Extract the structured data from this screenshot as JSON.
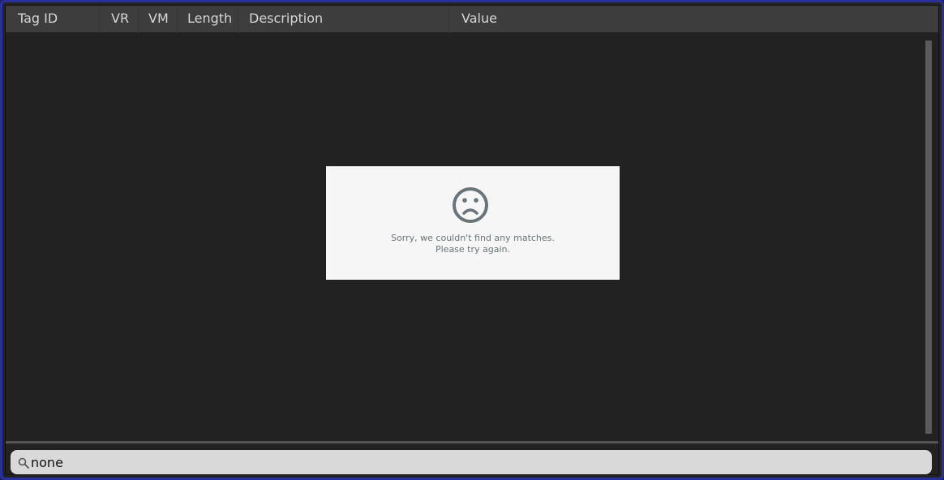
{
  "table": {
    "columns": [
      {
        "label": "Tag ID"
      },
      {
        "label": "VR"
      },
      {
        "label": "VM"
      },
      {
        "label": "Length"
      },
      {
        "label": "Description"
      },
      {
        "label": "Value"
      }
    ],
    "rows": []
  },
  "empty_state": {
    "icon": "sad-face-icon",
    "line1": "Sorry, we couldn't find any matches.",
    "line2": "Please try again."
  },
  "search": {
    "icon": "search-icon",
    "value": "none"
  },
  "colors": {
    "frame": "#2b2f9a",
    "header_bg": "#3d3d3d",
    "grid_bg": "#222222",
    "panel_bg": "#f6f6f6",
    "search_bg": "#d9d9d9"
  }
}
